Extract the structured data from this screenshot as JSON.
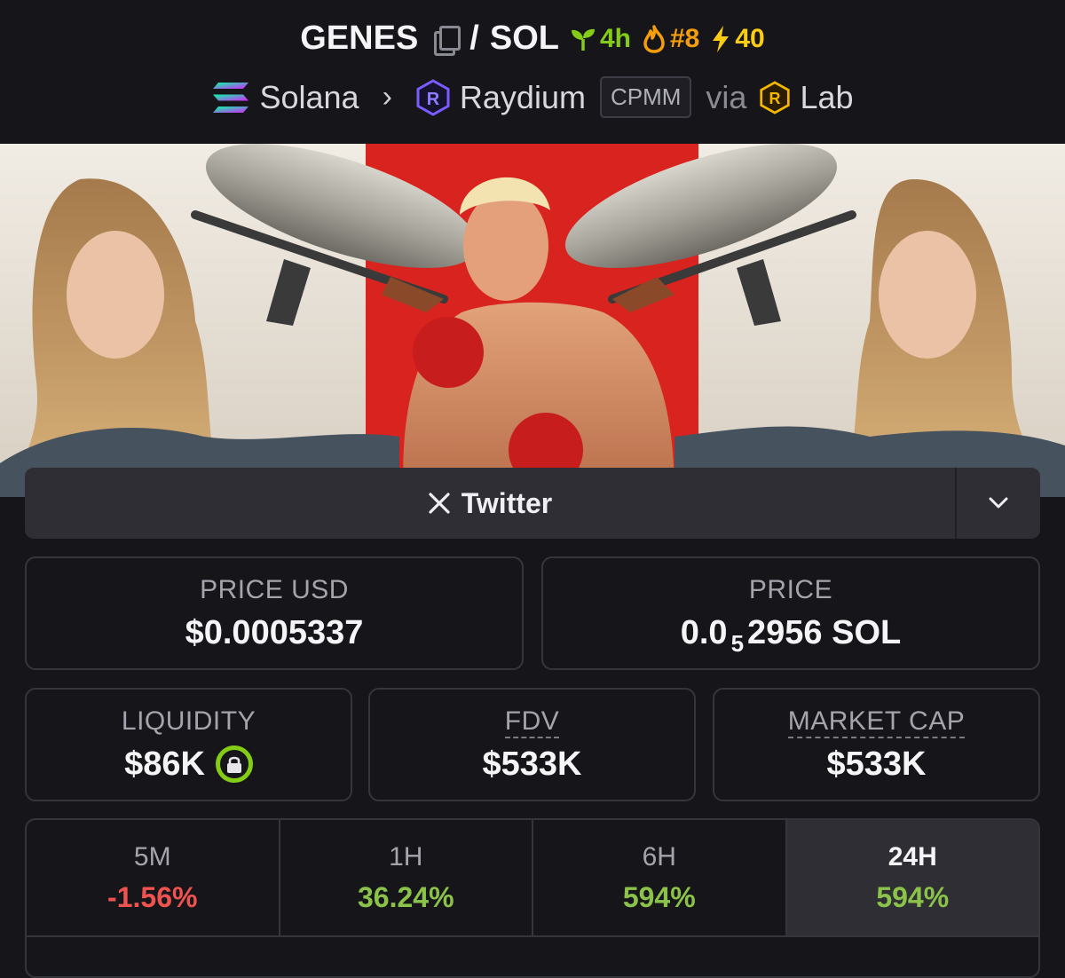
{
  "header": {
    "token": "GENES",
    "separator": "/",
    "quote": "SOL",
    "age": "4h",
    "rank": "#8",
    "boosts": "40",
    "chain": "Solana",
    "dex": "Raydium",
    "pool_type": "CPMM",
    "via_label": "via",
    "launchpad": "Lab"
  },
  "social": {
    "label": "Twitter"
  },
  "stats": {
    "price_usd_label": "PRICE USD",
    "price_usd": "$0.0005337",
    "price_label": "PRICE",
    "price_prefix": "0.0",
    "price_zeros": "5",
    "price_suffix": "2956 SOL",
    "liquidity_label": "LIQUIDITY",
    "liquidity": "$86K",
    "fdv_label": "FDV",
    "fdv": "$533K",
    "mcap_label": "MARKET CAP",
    "mcap": "$533K"
  },
  "changes": [
    {
      "period": "5M",
      "value": "-1.56%",
      "direction": "negative"
    },
    {
      "period": "1H",
      "value": "36.24%",
      "direction": "positive"
    },
    {
      "period": "6H",
      "value": "594%",
      "direction": "positive"
    },
    {
      "period": "24H",
      "value": "594%",
      "direction": "positive",
      "selected": true
    }
  ],
  "colors": {
    "background": "#16161a",
    "positive": "#8bc34a",
    "negative": "#ef5350",
    "age": "#84cc16",
    "rank": "#f59e0b",
    "boost": "#facc15",
    "raydium": "#7c5cff"
  }
}
